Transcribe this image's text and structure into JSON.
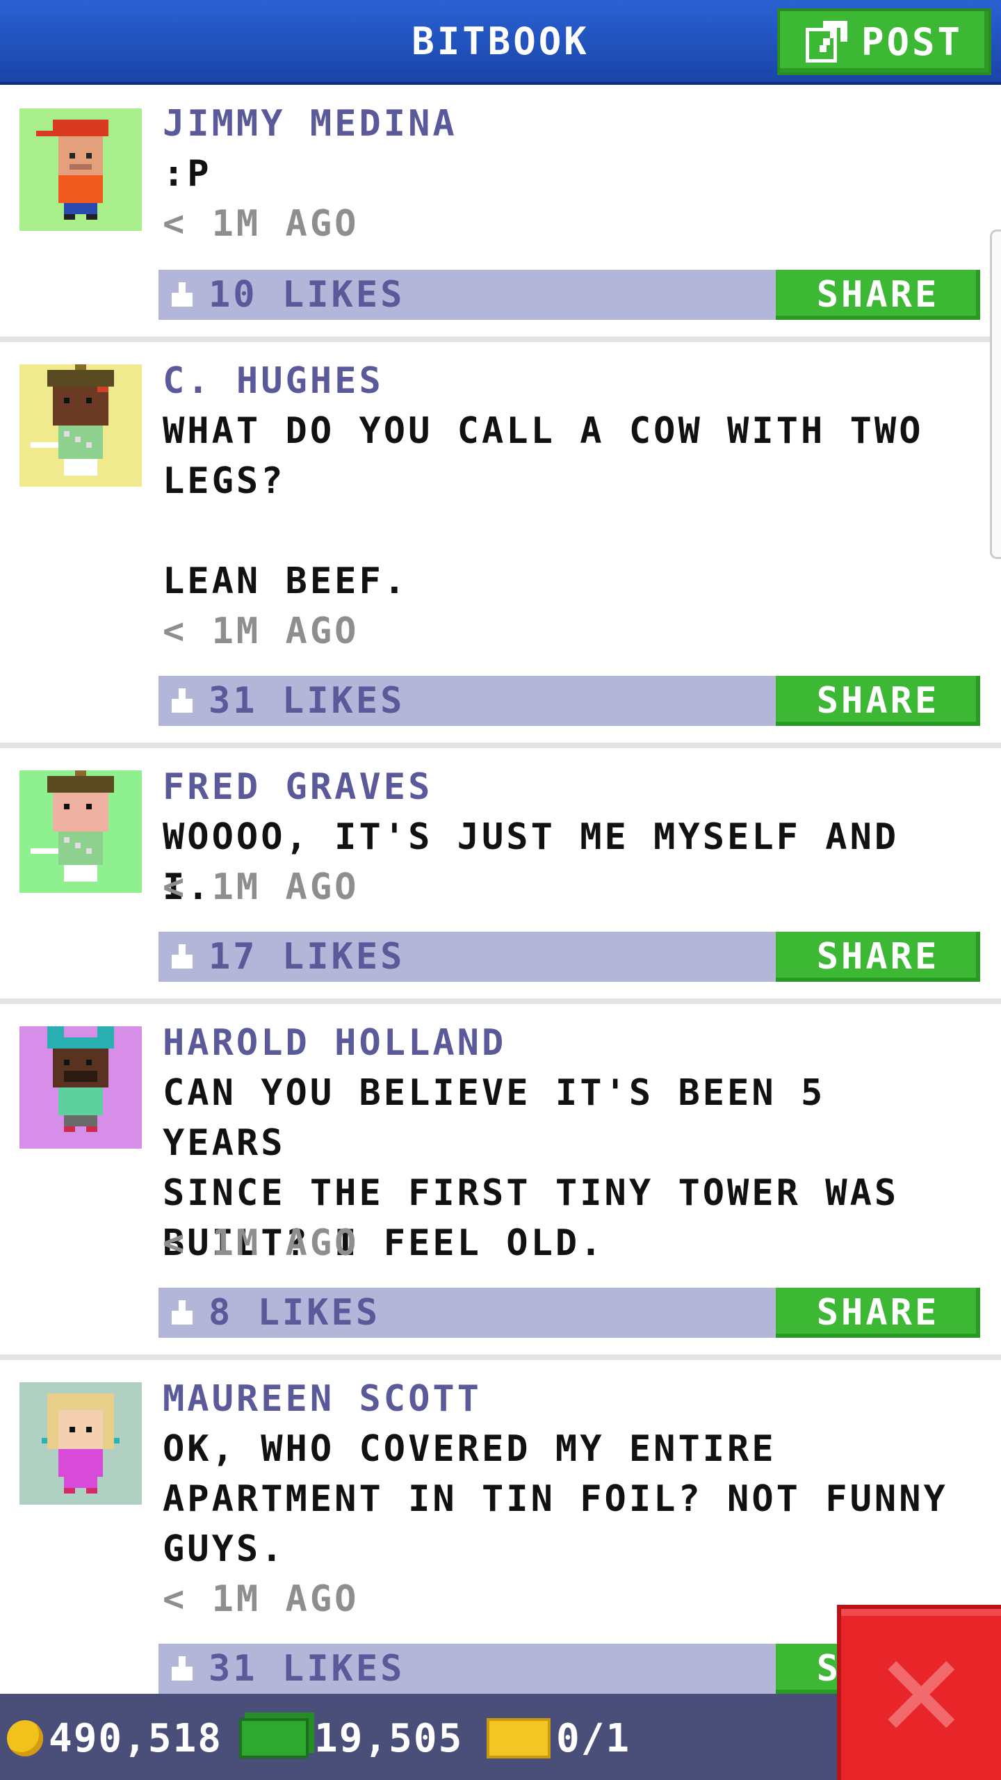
{
  "header": {
    "title": "BITBOOK",
    "post_label": "POST"
  },
  "posts": [
    {
      "name": "JIMMY MEDINA",
      "text": ":P",
      "time": "< 1M AGO",
      "likes": "10 LIKES",
      "share": "SHARE",
      "avatar_bg": "#a8ee8a"
    },
    {
      "name": "C. HUGHES",
      "text": "WHAT DO YOU CALL A COW WITH TWO\nLEGS?\n\nLEAN BEEF.",
      "time": "< 1M AGO",
      "likes": "31 LIKES",
      "share": "SHARE",
      "avatar_bg": "#f0ea8e"
    },
    {
      "name": "FRED GRAVES",
      "text": "WOOOO, IT'S JUST ME MYSELF AND I.",
      "time": "< 1M AGO",
      "likes": "17 LIKES",
      "share": "SHARE",
      "avatar_bg": "#8ef08e"
    },
    {
      "name": "HAROLD HOLLAND",
      "text": "CAN YOU BELIEVE IT'S BEEN 5 YEARS\nSINCE THE FIRST TINY TOWER WAS\nBUILT? I FEEL OLD.",
      "time": "< 1M AGO",
      "likes": "8 LIKES",
      "share": "SHARE",
      "avatar_bg": "#d78ee8"
    },
    {
      "name": "MAUREEN SCOTT",
      "text": "OK, WHO COVERED MY ENTIRE\nAPARTMENT IN TIN FOIL? NOT FUNNY\nGUYS.",
      "time": "< 1M AGO",
      "likes": "31 LIKES",
      "share": "SHARE",
      "avatar_bg": "#b0d1c1"
    }
  ],
  "footer": {
    "coins": "490,518",
    "bux": "19,505",
    "tickets": "0/1"
  },
  "colors": {
    "header_blue": "#2a62d4",
    "share_green": "#3cb835",
    "likes_bar": "#b3b6d9",
    "name_purple": "#5a5a9a",
    "close_red": "#e8262a",
    "footer_bg": "#4a4f7a"
  }
}
